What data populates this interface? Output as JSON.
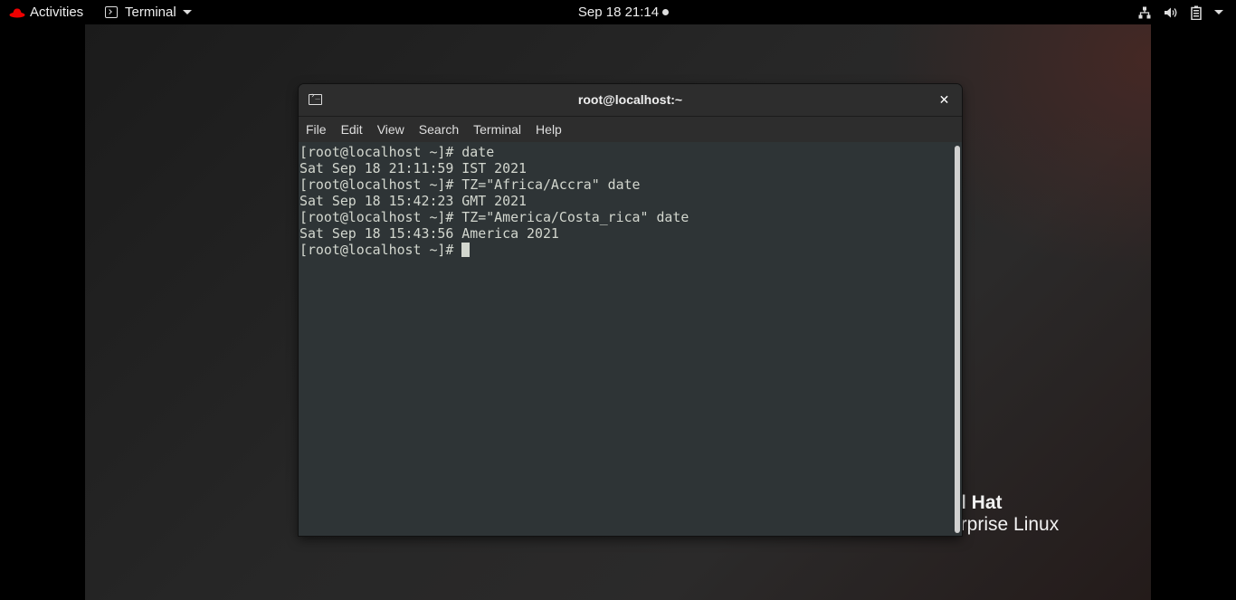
{
  "topbar": {
    "activities_label": "Activities",
    "app_menu_label": "Terminal",
    "clock": "Sep 18  21:14",
    "tray_icons": [
      "network-icon",
      "volume-icon",
      "battery-icon",
      "system-menu-caret-icon"
    ]
  },
  "desktop": {
    "brand_line1": "l Hat",
    "brand_line2": "erprise Linux"
  },
  "terminal": {
    "title": "root@localhost:~",
    "close_glyph": "✕",
    "menu": [
      "File",
      "Edit",
      "View",
      "Search",
      "Terminal",
      "Help"
    ],
    "lines": [
      "[root@localhost ~]# date",
      "Sat Sep 18 21:11:59 IST 2021",
      "[root@localhost ~]# TZ=\"Africa/Accra\" date",
      "Sat Sep 18 15:42:23 GMT 2021",
      "[root@localhost ~]# TZ=\"America/Costa_rica\" date",
      "Sat Sep 18 15:43:56 America 2021"
    ],
    "prompt": "[root@localhost ~]# "
  },
  "colors": {
    "terminal_bg": "#2e3436",
    "terminal_fg": "#d3d7cf",
    "titlebar_bg": "#2d2d2d",
    "brand_red": "#ee0000"
  }
}
